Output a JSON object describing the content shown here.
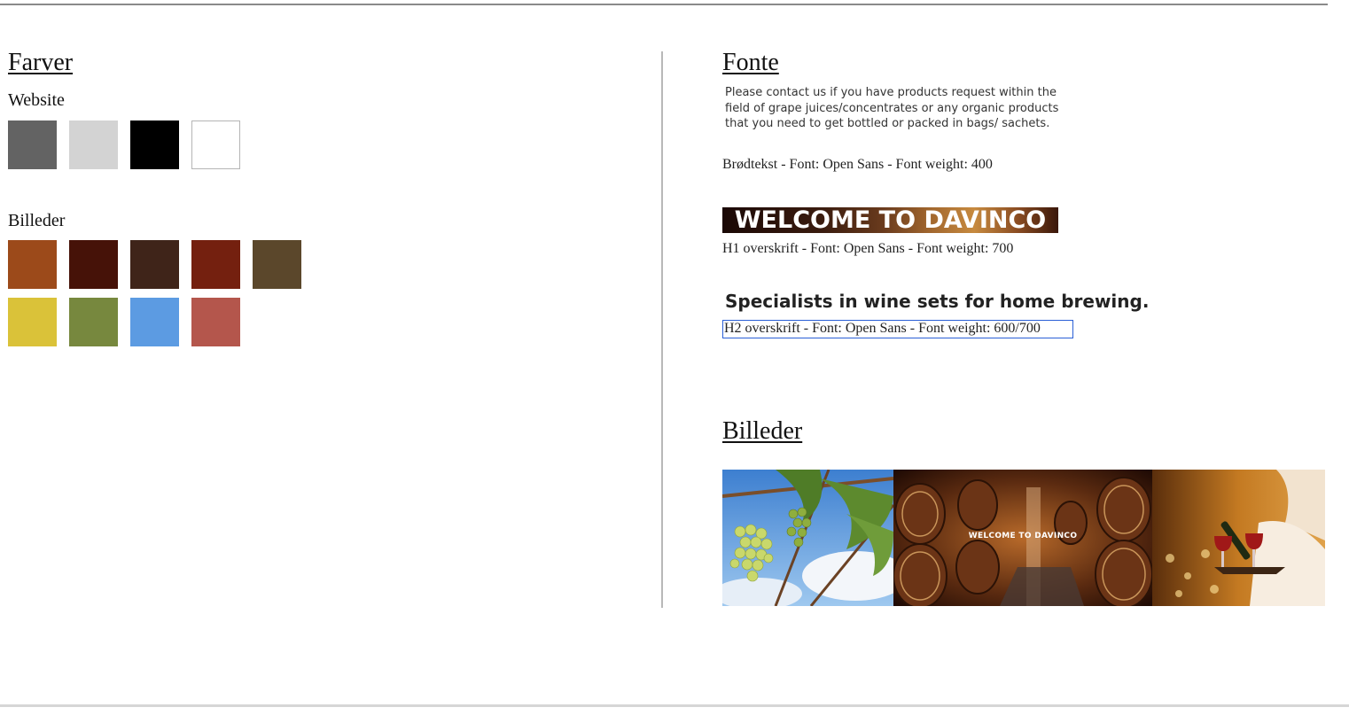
{
  "left": {
    "title": "Farver",
    "website": {
      "label": "Website",
      "swatches": [
        "#636363",
        "#d3d3d3",
        "#000000",
        "#ffffff"
      ]
    },
    "images": {
      "label": "Billeder",
      "swatches_row1": [
        "#9c4a1a",
        "#461208",
        "#3f2419",
        "#74200f",
        "#5b472b"
      ],
      "swatches_row2": [
        "#dac239",
        "#77883e",
        "#5c9be2",
        "#b4564c"
      ]
    }
  },
  "right": {
    "title": "Fonte",
    "body_sample": "Please contact us if you have products request within the field of grape juices/concentrates or any organic products that you need to get bottled or packed in bags/ sachets.",
    "body_caption": "Brødtekst - Font: Open Sans - Font weight: 400",
    "h1_sample": "WELCOME TO DAVINCO",
    "h1_caption": "H1 overskrift - Font: Open Sans - Font weight: 700",
    "h2_sample": "Specialists in wine sets for home brewing.",
    "h2_caption": "H2 overskrift - Font: Open Sans - Font weight: 600/700",
    "images_title": "Billeder",
    "photo_overlay": "WELCOME TO DAVINCO"
  }
}
